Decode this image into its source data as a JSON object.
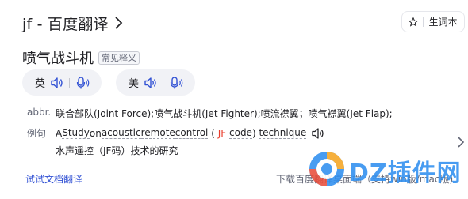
{
  "header": {
    "title": "jf - 百度翻译",
    "wordbook_label": "生词本"
  },
  "entry": {
    "word": "喷气战斗机",
    "tag": "常见释义"
  },
  "pronunciations": [
    {
      "label": "英"
    },
    {
      "label": "美"
    }
  ],
  "definition": {
    "pos": "abbr.",
    "text": "联合部队(Joint Force);喷气战斗机(Jet Fighter);喷流襟翼；喷气襟翼(Jet Flap);"
  },
  "example": {
    "label": "例句",
    "en_prefix": "A ",
    "en_study": "Study",
    "en_on": " on ",
    "en_acoustic": "acoustic",
    "en_space1": " ",
    "en_remote": "remote",
    "en_space2": " ",
    "en_control": "control",
    "en_paren_open": " ( ",
    "en_kw": "JF",
    "en_space3": " ",
    "en_code": "code",
    "en_paren_close": ") ",
    "en_technique": "technique",
    "cn": "水声遥控（JF码）技术的研究"
  },
  "footer": {
    "doc_link": "试试文档翻译",
    "download": "下载百度翻译桌面端（支持win版/mac版)"
  },
  "watermark": {
    "text": "DZ插件网"
  },
  "colors": {
    "accent_blue": "#3151d4",
    "keyword_red": "#e93c2b",
    "pill_bg": "#f1f2f6",
    "watermark_blue": "#2f8ff0"
  },
  "icons": {
    "title_chevron": "chevron-right-icon",
    "wordbook": "star-icon",
    "speaker": "speaker-icon",
    "mic": "mic-icon",
    "next": "chevron-right-icon"
  }
}
